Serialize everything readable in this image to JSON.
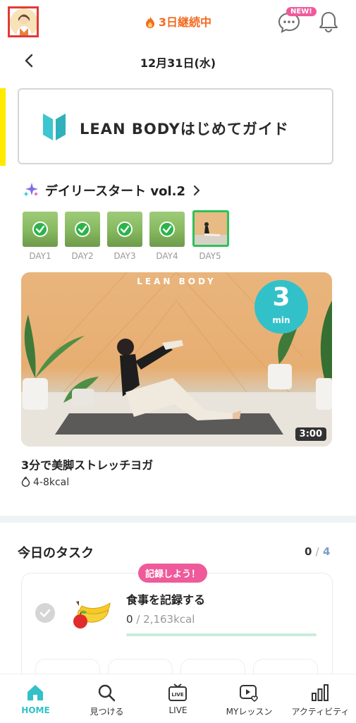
{
  "header": {
    "streak_text": "3日継続中",
    "new_badge": "NEW!",
    "date": "12月31日(水)"
  },
  "guide": {
    "label": "LEAN BODYはじめてガイド"
  },
  "daily": {
    "title": "デイリースタート vol.2",
    "days": [
      {
        "label": "DAY1",
        "done": true
      },
      {
        "label": "DAY2",
        "done": true
      },
      {
        "label": "DAY3",
        "done": true
      },
      {
        "label": "DAY4",
        "done": true
      },
      {
        "label": "DAY5",
        "done": false,
        "current": true
      }
    ]
  },
  "video": {
    "brand": "LEAN BODY",
    "duration_number": "3",
    "duration_unit": "min",
    "time": "3:00",
    "title": "3分で美脚ストレッチヨガ",
    "kcal": "4-8kcal"
  },
  "tasks": {
    "title": "今日のタスク",
    "done": "0",
    "separator": "/",
    "total": "4",
    "bubble": "記録しよう！",
    "item_name": "食事を記録する",
    "item_value": "0",
    "item_target": "/ 2,163kcal",
    "progress": 0.0
  },
  "nav": {
    "items": [
      {
        "label": "HOME",
        "icon": "home-icon",
        "active": true
      },
      {
        "label": "見つける",
        "icon": "search-icon",
        "active": false
      },
      {
        "label": "LIVE",
        "icon": "live-tv-icon",
        "active": false
      },
      {
        "label": "MYレッスン",
        "icon": "my-lesson-icon",
        "active": false
      },
      {
        "label": "アクティビティ",
        "icon": "activity-chart-icon",
        "active": false
      }
    ]
  },
  "colors": {
    "accent_teal": "#33c1c9",
    "streak_orange": "#f36b21",
    "pink": "#ef5a9b",
    "check_green": "#2db34a"
  }
}
